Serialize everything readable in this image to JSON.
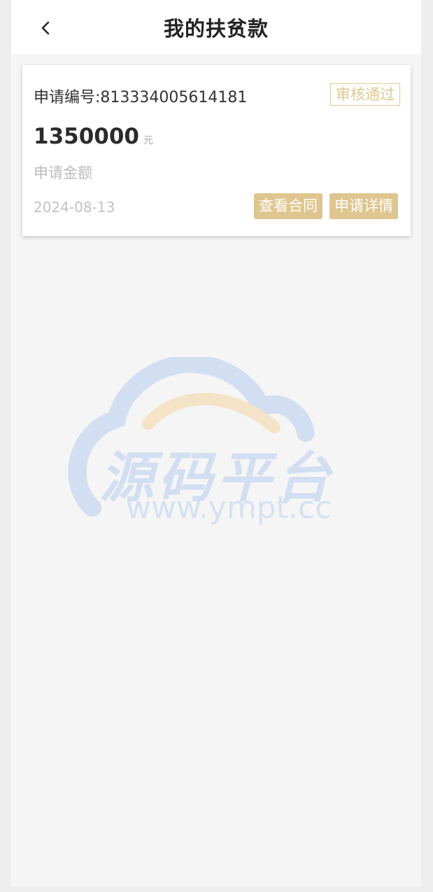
{
  "header": {
    "title": "我的扶贫款"
  },
  "application": {
    "number_label": "申请编号:",
    "number": "813334005614181",
    "status": "审核通过",
    "amount": "1350000",
    "unit": "元",
    "amount_label": "申请金额",
    "date": "2024-08-13",
    "actions": {
      "view_contract": "查看合同",
      "view_detail": "申请详情"
    }
  },
  "watermark": {
    "brand": "源码平台",
    "url": "www.ympt.cc"
  },
  "colors": {
    "accent": "#dfc690",
    "page_bg": "#f5f5f5",
    "watermark_blue": "#b6cdf0",
    "watermark_orange": "#f5d5a5"
  }
}
